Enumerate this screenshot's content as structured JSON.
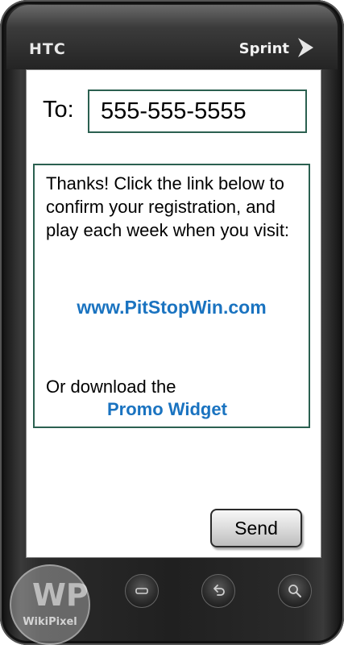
{
  "device": {
    "brand_left": "HTC",
    "brand_right": "Sprint",
    "colors": {
      "frame": "#202020",
      "accent_border": "#2b6050",
      "link": "#1a73c0"
    }
  },
  "compose": {
    "to_label": "To:",
    "to_value": "555-555-5555"
  },
  "message": {
    "body": "Thanks!  Click the link below to confirm your registration, and play each week when you visit:",
    "link_site": "www.PitStopWin.com",
    "download_prefix": "Or download the",
    "link_widget": "Promo Widget"
  },
  "actions": {
    "send_label": "Send"
  },
  "nav_buttons": {
    "menu_icon": "menu-icon",
    "back_icon": "back-icon",
    "search_icon": "search-icon"
  },
  "watermark": {
    "logo": "WP",
    "text": "WikiPixel"
  }
}
